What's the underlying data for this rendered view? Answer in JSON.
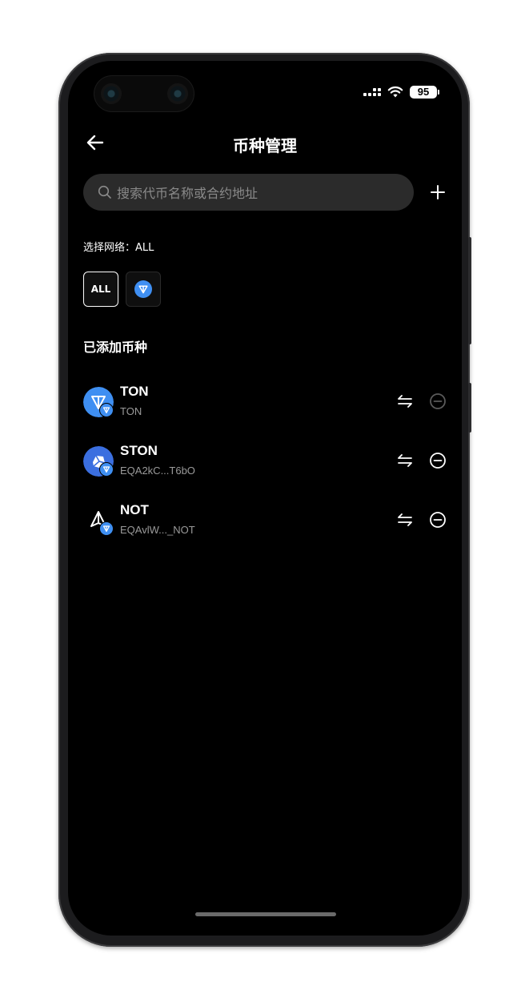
{
  "status_bar": {
    "battery": "95"
  },
  "header": {
    "title": "币种管理"
  },
  "search": {
    "placeholder": "搜索代币名称或合约地址"
  },
  "network": {
    "label": "选择网络：ALL",
    "chips": [
      {
        "label": "ALL",
        "selected": true
      },
      {
        "icon": "ton-network-icon",
        "selected": false
      }
    ]
  },
  "added_section": {
    "title": "已添加币种"
  },
  "tokens": [
    {
      "name": "TON",
      "address": "TON",
      "icon": "ton-logo-icon",
      "remove_enabled": false
    },
    {
      "name": "STON",
      "address": "EQA2kC...T6bO",
      "icon": "ston-logo-icon",
      "remove_enabled": true
    },
    {
      "name": "NOT",
      "address": "EQAvlW..._NOT",
      "icon": "not-logo-icon",
      "remove_enabled": true
    }
  ],
  "colors": {
    "background": "#000000",
    "search_bg": "#2b2b2b",
    "ton_blue": "#3f8ff2",
    "muted_text": "#9a9a9a",
    "disabled_icon": "#5a5a5a"
  }
}
